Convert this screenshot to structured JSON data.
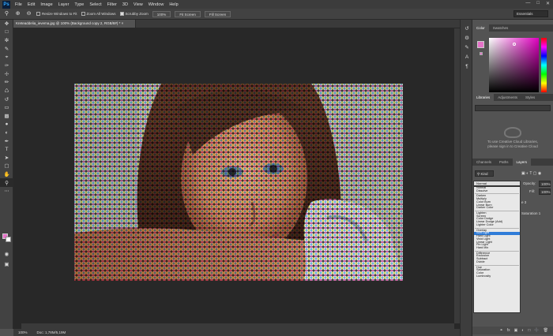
{
  "app": {
    "logo": "Ps"
  },
  "menu": [
    "File",
    "Edit",
    "Image",
    "Layer",
    "Type",
    "Select",
    "Filter",
    "3D",
    "View",
    "Window",
    "Help"
  ],
  "window_controls": {
    "minimize": "—",
    "maximize": "□",
    "close": "✕"
  },
  "options_bar": {
    "resize_windows": "Resize Windows to Fit",
    "zoom_all": "Zoom All Windows",
    "scrubby_zoom": "Scrubby Zoom",
    "zoom_value": "100%",
    "fit_screen": "Fit Screen",
    "fill_screen": "Fill Screen",
    "workspace": "Essentials"
  },
  "document": {
    "tab_title": "Kreteaddelia_ievema.jpg @ 100% (Background copy 2, RGB/8#) *",
    "tab_close": "×",
    "zoom": "100%",
    "doc_info": "Doc: 1,78M/5,19M"
  },
  "color_panel": {
    "tabs": [
      "Color",
      "Swatches"
    ],
    "fg_color": "#e572c8"
  },
  "libraries_panel": {
    "tabs": [
      "Libraries",
      "Adjustments",
      "Styles"
    ],
    "message_line1": "To use Creative Cloud Libraries,",
    "message_line2": "please sign in to Creative Cloud"
  },
  "layers_panel": {
    "tabs": [
      "Channels",
      "Paths",
      "Layers"
    ],
    "kind": "Kind",
    "blend_current": "Normal",
    "opacity_label": "Opacity:",
    "opacity_value": "100%",
    "fill_label": "Fill:",
    "fill_value": "100%",
    "layer_visible_1": "e 3",
    "layer_visible_2": "Saturation 1"
  },
  "blend_modes": [
    {
      "group": [
        "Normal",
        "Dissolve"
      ]
    },
    {
      "group": [
        "Darken",
        "Multiply",
        "Color Burn",
        "Linear Burn",
        "Darker Color"
      ]
    },
    {
      "group": [
        "Lighten",
        "Screen",
        "Color Dodge",
        "Linear Dodge (Add)",
        "Lighter Color"
      ]
    },
    {
      "group": [
        "Overlay",
        "Soft Light",
        "Hard Light",
        "Vivid Light",
        "Linear Light",
        "Pin Light",
        "Hard Mix"
      ]
    },
    {
      "group": [
        "Difference",
        "Exclusion",
        "Subtract",
        "Divide"
      ]
    },
    {
      "group": [
        "Hue",
        "Saturation",
        "Color",
        "Luminosity"
      ]
    }
  ],
  "blend_selected": "Soft Light"
}
